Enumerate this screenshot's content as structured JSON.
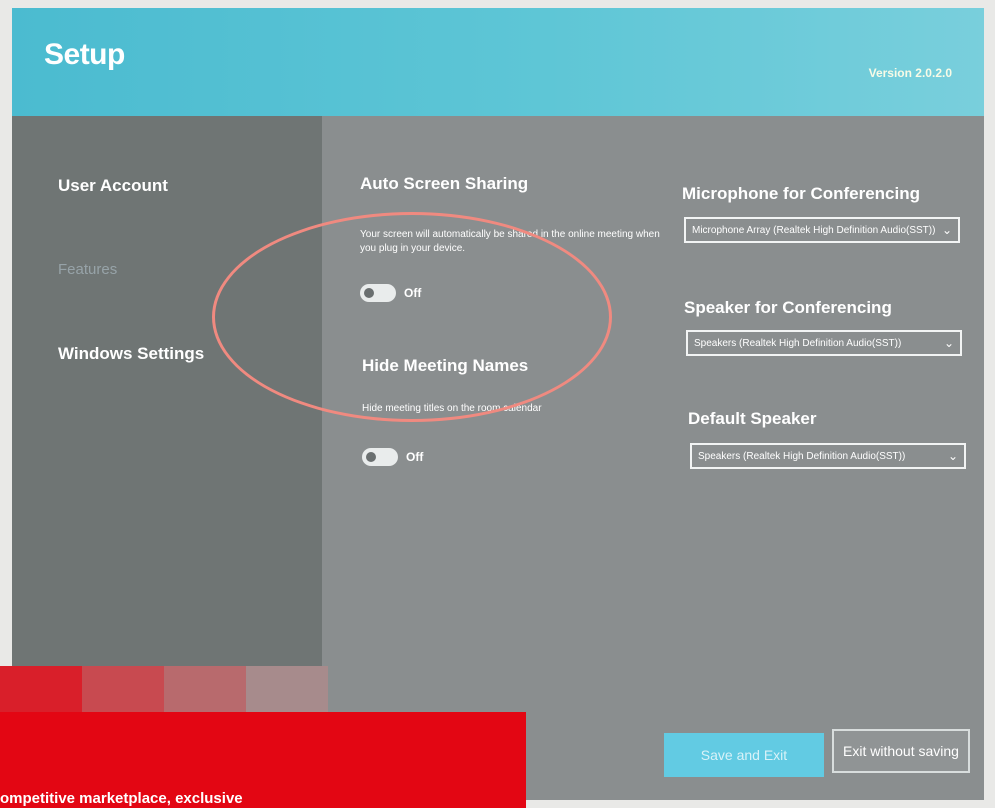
{
  "window": {
    "title": "Setup",
    "version": "Version 2.0.2.0"
  },
  "sidebar": {
    "items": [
      {
        "label": "User Account"
      },
      {
        "label": "Features"
      },
      {
        "label": "Windows Settings"
      }
    ]
  },
  "features": {
    "auto_screen_sharing": {
      "title": "Auto Screen Sharing",
      "description": "Your screen will automatically be shared in the online meeting when you plug in your device.",
      "state": "Off"
    },
    "hide_meeting_names": {
      "title": "Hide Meeting Names",
      "description": "Hide meeting titles on the room calendar",
      "state": "Off"
    }
  },
  "audio": {
    "microphone": {
      "label": "Microphone for Conferencing",
      "value": "Microphone Array (Realtek High Definition Audio(SST))"
    },
    "speaker": {
      "label": "Speaker for Conferencing",
      "value": "Speakers (Realtek High Definition Audio(SST))"
    },
    "default_speaker": {
      "label": "Default Speaker",
      "value": "Speakers (Realtek High Definition Audio(SST))"
    }
  },
  "buttons": {
    "save": "Save and Exit",
    "exit": "Exit without saving"
  },
  "banner": {
    "text": "ompetitive marketplace, exclusive"
  },
  "colors": {
    "header": "#5ec6d6",
    "annotation_circle": "#f08a80",
    "banner_red": "#e30613",
    "tiles": [
      "#d91f2a",
      "#c84a50",
      "#b86a6d",
      "#a78b8c"
    ]
  }
}
